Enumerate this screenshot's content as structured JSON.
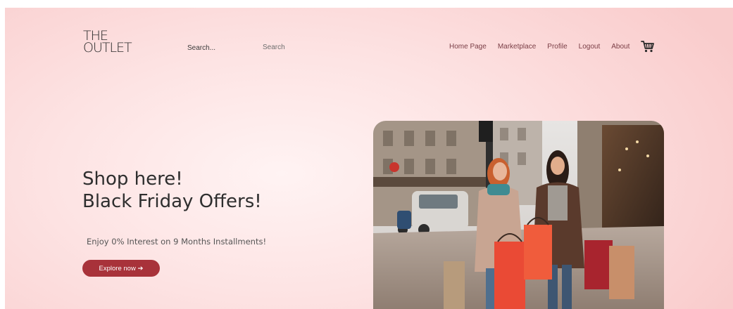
{
  "header": {
    "logo_line1": "THE",
    "logo_line2": "OUTLET",
    "search_placeholder": "Search...",
    "search_button": "Search",
    "nav": [
      "Home Page",
      "Marketplace",
      "Profile",
      "Logout",
      "About"
    ],
    "cart_icon": "shopping-cart-icon"
  },
  "hero": {
    "title_line1": "Shop here!",
    "title_line2": "Black Friday Offers!",
    "subtitle": "Enjoy 0% Interest on 9 Months Installments!",
    "cta": "Explore now ➔",
    "cta_color": "#a8323a",
    "image": "photo-two-women-shopping-bags-street"
  },
  "colors": {
    "background": "#fbd9d9",
    "nav_text": "#7a3e46",
    "title_text": "#2e2e2e"
  }
}
